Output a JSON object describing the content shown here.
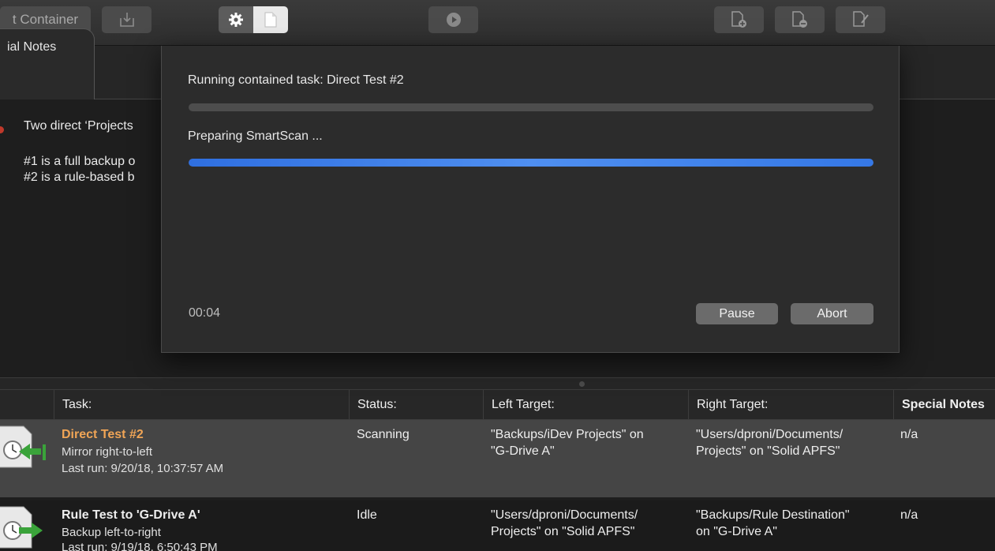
{
  "toolbar": {
    "container_label": "t Container",
    "icons": [
      "import-icon",
      "gear-icon",
      "document-icon",
      "play-icon",
      "add-document-icon",
      "remove-document-icon",
      "edit-document-icon"
    ]
  },
  "notes": {
    "tab_label": "ial Notes",
    "lines": [
      "Two direct ‘Projects",
      "#1 is a full backup o",
      "#2 is a rule-based b"
    ]
  },
  "dialog": {
    "running_label": "Running contained task:  Direct Test #2",
    "overall_progress": 0,
    "status": "Preparing SmartScan ...",
    "step_progress": 1.0,
    "elapsed": "00:04",
    "pause_label": "Pause",
    "abort_label": "Abort"
  },
  "table": {
    "headers": {
      "task": "Task:",
      "status": "Status:",
      "left": "Left Target:",
      "right": "Right Target:",
      "notes": "Special Notes"
    },
    "rows": [
      {
        "name": "Direct Test #2",
        "mode": "Mirror right-to-left",
        "last_run": "Last run: 9/20/18, 10:37:57 AM",
        "status": "Scanning",
        "left_1": "\"Backups/iDev Projects\" on",
        "left_2": "\"G-Drive A\"",
        "right_1": "\"Users/dproni/Documents/",
        "right_2": "Projects\" on \"Solid APFS\"",
        "notes": "n/a"
      },
      {
        "name": "Rule Test to 'G-Drive A'",
        "mode": "Backup left-to-right",
        "last_run": "Last run: 9/19/18, 6:50:43 PM",
        "status": "Idle",
        "left_1": "\"Users/dproni/Documents/",
        "left_2": "Projects\" on \"Solid APFS\"",
        "right_1": "\"Backups/Rule Destination\"",
        "right_2": "on \"G-Drive A\"",
        "notes": "n/a"
      }
    ]
  },
  "colors": {
    "active_task": "#f0a556",
    "progress_blue": "#3578e6",
    "arrow_green": "#3aa33a"
  }
}
